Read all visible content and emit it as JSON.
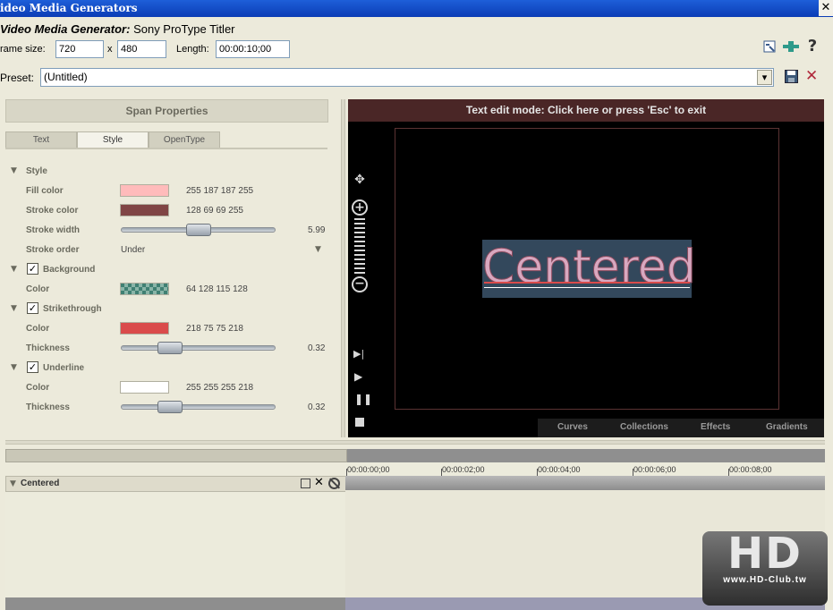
{
  "window": {
    "title": "ideo Media Generators",
    "close_glyph": "✕"
  },
  "generator": {
    "prefix": "Video Media Generator:",
    "name": "Sony ProType Titler"
  },
  "frame": {
    "size_label": "rame size:",
    "width": "720",
    "x_label": "x",
    "height": "480",
    "length_label": "Length:",
    "length": "00:00:10;00"
  },
  "toolbar_icons": [
    "properties-icon",
    "plugin-chain-icon",
    "help-icon"
  ],
  "preset": {
    "label": "Preset:",
    "value": "(Untitled)",
    "dropdown_glyph": "▾",
    "delete_glyph": "✕"
  },
  "span_panel": {
    "title": "Span Properties",
    "tabs": [
      "Text",
      "Style",
      "OpenType"
    ],
    "active_tab": "Style",
    "sections": {
      "style": {
        "label": "Style"
      },
      "fill_color": {
        "label": "Fill color",
        "value": "255 187 187 255",
        "color": "#ffbbbb"
      },
      "stroke_color": {
        "label": "Stroke color",
        "value": "128 69 69 255",
        "color": "#804545"
      },
      "stroke_width": {
        "label": "Stroke width",
        "value": "5.99",
        "fraction": 0.5
      },
      "stroke_order": {
        "label": "Stroke order",
        "value": "Under"
      },
      "background": {
        "label": "Background",
        "checked": true
      },
      "bg_color": {
        "label": "Color",
        "value": "64 128 115 128",
        "color": "#408073"
      },
      "strikethrough": {
        "label": "Strikethrough",
        "checked": true
      },
      "strike_color": {
        "label": "Color",
        "value": "218 75 75 218",
        "color": "#da4b4b"
      },
      "strike_thickness": {
        "label": "Thickness",
        "value": "0.32",
        "fraction": 0.32
      },
      "underline": {
        "label": "Underline",
        "checked": true
      },
      "underline_color": {
        "label": "Color",
        "value": "255 255 255 218",
        "color": "#ffffff"
      },
      "underline_thickness": {
        "label": "Thickness",
        "value": "0.32",
        "fraction": 0.32
      }
    }
  },
  "preview": {
    "edit_mode": "Text edit mode: Click here or press 'Esc' to exit",
    "text": "Centered",
    "bottom_tabs": [
      "Curves",
      "Collections",
      "Effects",
      "Gradients"
    ]
  },
  "timeline": {
    "ticks": [
      "00:00:00;00",
      "00:00:02;00",
      "00:00:04;00",
      "00:00:06;00",
      "00:00:08;00"
    ],
    "track_name": "Centered"
  },
  "watermark": {
    "main": "HD",
    "sub": "www.HD-Club.tw"
  }
}
